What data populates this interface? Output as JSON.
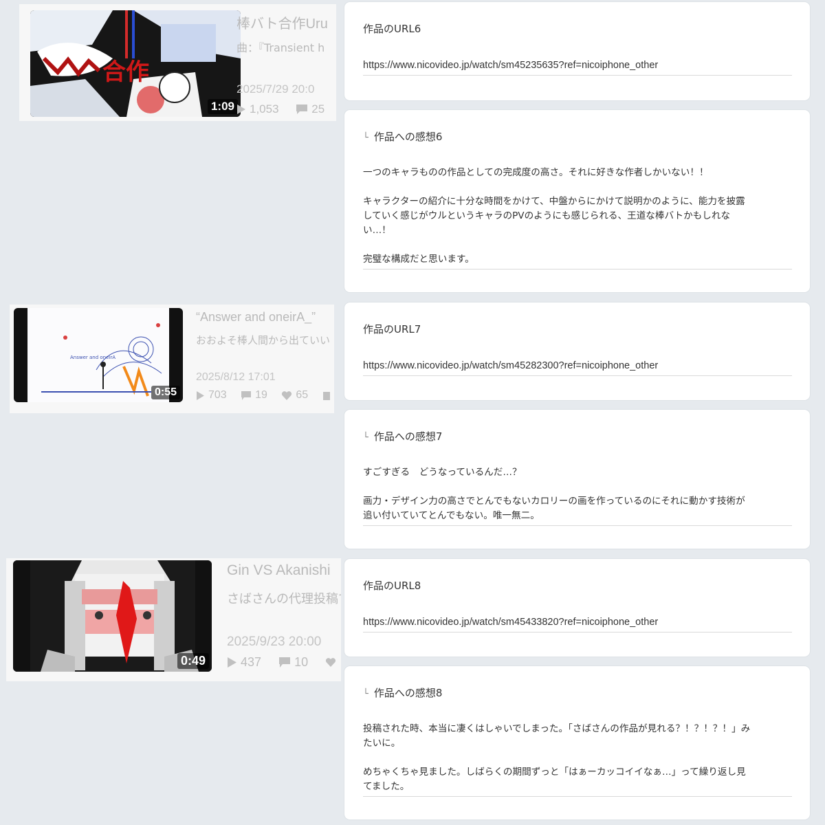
{
  "videos": [
    {
      "title": "棒バト合作Uru",
      "desc": "曲：『Transient h",
      "date": "2025/7/29 20:0",
      "duration": "1:09",
      "views": "1,053",
      "comments": "25",
      "likes": "",
      "thumb_text": "合作"
    },
    {
      "title": "“Answer and oneirA_”",
      "desc": "おおよそ棒人間から出ていい",
      "date": "2025/8/12 17:01",
      "duration": "0:55",
      "views": "703",
      "comments": "19",
      "likes": "65",
      "thumb_text": "Answer and oneirA"
    },
    {
      "title": "Gin VS Akanishi",
      "desc": "さばさんの代理投稿で",
      "date": "2025/9/23 20:00",
      "duration": "0:49",
      "views": "437",
      "comments": "10",
      "likes": ""
    }
  ],
  "entries": [
    {
      "url_label": "作品のURL6",
      "url": "https://www.nicovideo.jp/watch/sm45235635?ref=nicoiphone_other",
      "impression_label": "作品への感想6",
      "impression": "一つのキャラものの作品としての完成度の高さ。それに好きな作者しかいない！！\n\nキャラクターの紹介に十分な時間をかけて、中盤からにかけて説明かのように、能力を披露\nしていく感じがウルというキャラのPVのようにも感じられる、王道な棒バトかもしれな\nい…！\n\n完璧な構成だと思います。"
    },
    {
      "url_label": "作品のURL7",
      "url": "https://www.nicovideo.jp/watch/sm45282300?ref=nicoiphone_other",
      "impression_label": "作品への感想7",
      "impression": "すごすぎる　どうなっているんだ…？\n\n画力・デザイン力の高さでとんでもないカロリーの画を作っているのにそれに動かす技術が\n追い付いていてとんでもない。唯一無二。"
    },
    {
      "url_label": "作品のURL8",
      "url": "https://www.nicovideo.jp/watch/sm45433820?ref=nicoiphone_other",
      "impression_label": "作品への感想8",
      "impression": "投稿された時、本当に凄くはしゃいでしまった。「さばさんの作品が見れる？！？！？！」み\nたいに。\n\nめちゃくちゃ見ました。しばらくの期間ずっと「はぁーカッコイイなぁ…」って繰り返し見\nてました。"
    }
  ],
  "sub_mark": "└",
  "colors": {
    "background": "#e6eaee",
    "card": "#ffffff",
    "muted_text": "#b9b9b9"
  }
}
